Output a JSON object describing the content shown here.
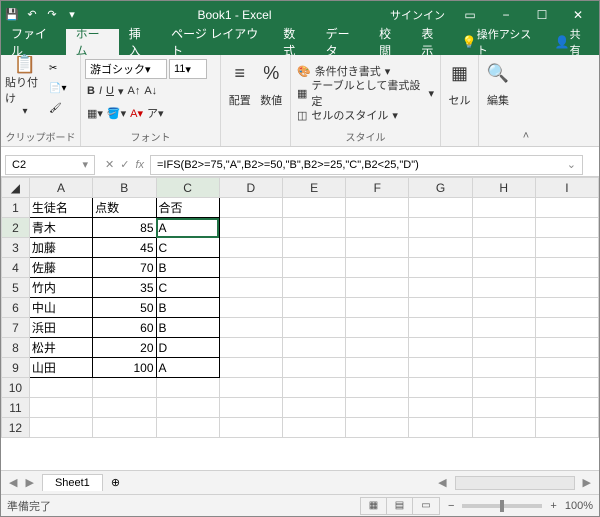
{
  "titlebar": {
    "title": "Book1 - Excel",
    "signin": "サインイン"
  },
  "menu": {
    "file": "ファイル",
    "home": "ホーム",
    "insert": "挿入",
    "layout": "ページ レイアウト",
    "formula": "数式",
    "data": "データ",
    "review": "校閲",
    "view": "表示",
    "assist": "操作アシスト",
    "share": "共有"
  },
  "ribbon": {
    "clipboard": {
      "paste": "貼り付け",
      "label": "クリップボード"
    },
    "font": {
      "name": "游ゴシック",
      "size": "11",
      "label": "フォント"
    },
    "align": {
      "align": "配置",
      "number": "数値"
    },
    "styles": {
      "cond": "条件付き書式",
      "table": "テーブルとして書式設定",
      "cell": "セルのスタイル",
      "label": "スタイル"
    },
    "cells": {
      "label": "セル"
    },
    "edit": {
      "label": "編集"
    }
  },
  "fx": {
    "name": "C2",
    "formula": "=IFS(B2>=75,\"A\",B2>=50,\"B\",B2>=25,\"C\",B2<25,\"D\")"
  },
  "sheet": {
    "cols": [
      "A",
      "B",
      "C",
      "D",
      "E",
      "F",
      "G",
      "H",
      "I"
    ],
    "rows": [
      "1",
      "2",
      "3",
      "4",
      "5",
      "6",
      "7",
      "8",
      "9",
      "10",
      "11",
      "12"
    ],
    "headers": {
      "a": "生徒名",
      "b": "点数",
      "c": "合否"
    },
    "data": [
      {
        "a": "青木",
        "b": "85",
        "c": "A"
      },
      {
        "a": "加藤",
        "b": "45",
        "c": "C"
      },
      {
        "a": "佐藤",
        "b": "70",
        "c": "B"
      },
      {
        "a": "竹内",
        "b": "35",
        "c": "C"
      },
      {
        "a": "中山",
        "b": "50",
        "c": "B"
      },
      {
        "a": "浜田",
        "b": "60",
        "c": "B"
      },
      {
        "a": "松井",
        "b": "20",
        "c": "D"
      },
      {
        "a": "山田",
        "b": "100",
        "c": "A"
      }
    ]
  },
  "tab": {
    "sheet": "Sheet1"
  },
  "status": {
    "ready": "準備完了",
    "zoom": "100%"
  }
}
